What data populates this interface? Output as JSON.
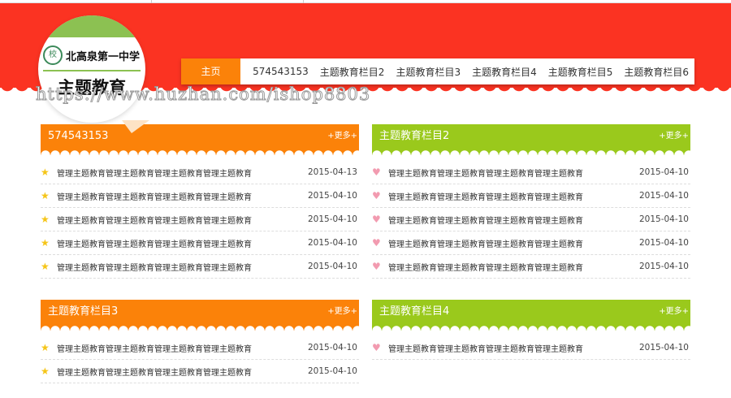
{
  "header": {
    "logo_school": "北高泉第一中学",
    "logo_seal": "校",
    "site_title": "主题教育",
    "watermark": "https://www.huzhan.com/ishop8803"
  },
  "nav": [
    "主页",
    "574543153",
    "主题教育栏目2",
    "主题教育栏目3",
    "主题教育栏目4",
    "主题教育栏目5",
    "主题教育栏目6"
  ],
  "panels": [
    {
      "title": "574543153",
      "more": "+更多+",
      "icon": "star-icon",
      "items": [
        {
          "t": "管理主题教育管理主题教育管理主题教育管理主题教育",
          "d": "2015-04-13"
        },
        {
          "t": "管理主题教育管理主题教育管理主题教育管理主题教育",
          "d": "2015-04-10"
        },
        {
          "t": "管理主题教育管理主题教育管理主题教育管理主题教育",
          "d": "2015-04-10"
        },
        {
          "t": "管理主题教育管理主题教育管理主题教育管理主题教育",
          "d": "2015-04-10"
        },
        {
          "t": "管理主题教育管理主题教育管理主题教育管理主题教育",
          "d": "2015-04-10"
        }
      ]
    },
    {
      "title": "主题教育栏目2",
      "more": "+更多+",
      "icon": "heart-icon",
      "items": [
        {
          "t": "管理主题教育管理主题教育管理主题教育管理主题教育",
          "d": "2015-04-10"
        },
        {
          "t": "管理主题教育管理主题教育管理主题教育管理主题教育",
          "d": "2015-04-10"
        },
        {
          "t": "管理主题教育管理主题教育管理主题教育管理主题教育",
          "d": "2015-04-10"
        },
        {
          "t": "管理主题教育管理主题教育管理主题教育管理主题教育",
          "d": "2015-04-10"
        },
        {
          "t": "管理主题教育管理主题教育管理主题教育管理主题教育",
          "d": "2015-04-10"
        }
      ]
    },
    {
      "title": "主题教育栏目3",
      "more": "+更多+",
      "icon": "star-icon",
      "items": [
        {
          "t": "管理主题教育管理主题教育管理主题教育管理主题教育",
          "d": "2015-04-10"
        },
        {
          "t": "管理主题教育管理主题教育管理主题教育管理主题教育",
          "d": "2015-04-10"
        }
      ]
    },
    {
      "title": "主题教育栏目4",
      "more": "+更多+",
      "icon": "heart-icon",
      "items": [
        {
          "t": "管理主题教育管理主题教育管理主题教育管理主题教育",
          "d": "2015-04-10"
        }
      ]
    }
  ]
}
